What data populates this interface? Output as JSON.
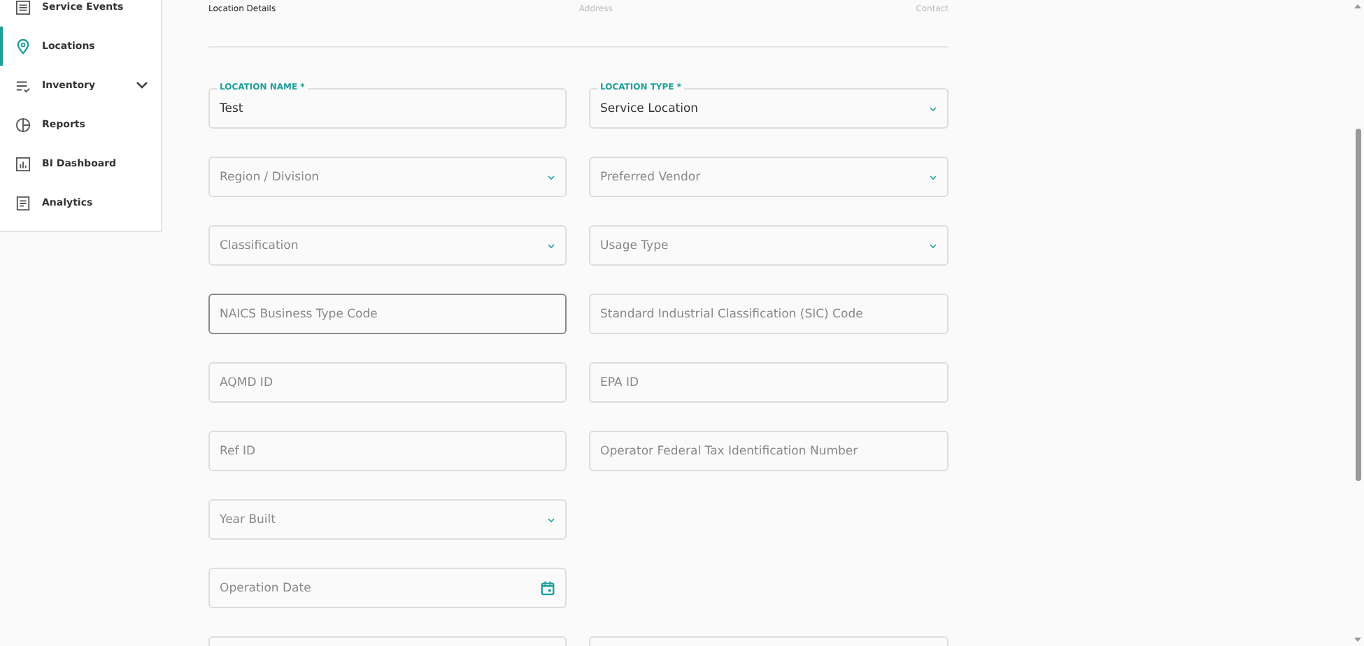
{
  "sidebar": {
    "items": [
      {
        "label": "Service Events",
        "selected": false
      },
      {
        "label": "Locations",
        "selected": true
      },
      {
        "label": "Inventory",
        "selected": false,
        "expandable": true
      },
      {
        "label": "Reports",
        "selected": false
      },
      {
        "label": "BI Dashboard",
        "selected": false
      },
      {
        "label": "Analytics",
        "selected": false
      }
    ]
  },
  "steps": [
    {
      "label": "Location Details",
      "selected": true
    },
    {
      "label": "Address",
      "selected": false
    },
    {
      "label": "Contact",
      "selected": false
    }
  ],
  "form": {
    "fields": [
      {
        "kind": "text",
        "label": "LOCATION NAME *",
        "value": "Test"
      },
      {
        "kind": "select",
        "label": "LOCATION TYPE *",
        "value": "Service Location"
      },
      {
        "kind": "select",
        "placeholder": "Region / Division"
      },
      {
        "kind": "select",
        "placeholder": "Preferred Vendor"
      },
      {
        "kind": "select",
        "placeholder": "Classification"
      },
      {
        "kind": "select",
        "placeholder": "Usage Type"
      },
      {
        "kind": "text",
        "placeholder": "NAICS Business Type Code",
        "focused": true
      },
      {
        "kind": "text",
        "placeholder": "Standard Industrial Classification (SIC) Code"
      },
      {
        "kind": "text",
        "placeholder": "AQMD ID"
      },
      {
        "kind": "text",
        "placeholder": "EPA ID"
      },
      {
        "kind": "text",
        "placeholder": "Ref ID"
      },
      {
        "kind": "text",
        "placeholder": "Operator Federal Tax Identification Number"
      },
      {
        "kind": "select",
        "placeholder": "Year Built"
      },
      {
        "kind": "spacer"
      },
      {
        "kind": "date",
        "placeholder": "Operation Date"
      },
      {
        "kind": "spacer"
      },
      {
        "kind": "text"
      },
      {
        "kind": "text"
      }
    ]
  }
}
